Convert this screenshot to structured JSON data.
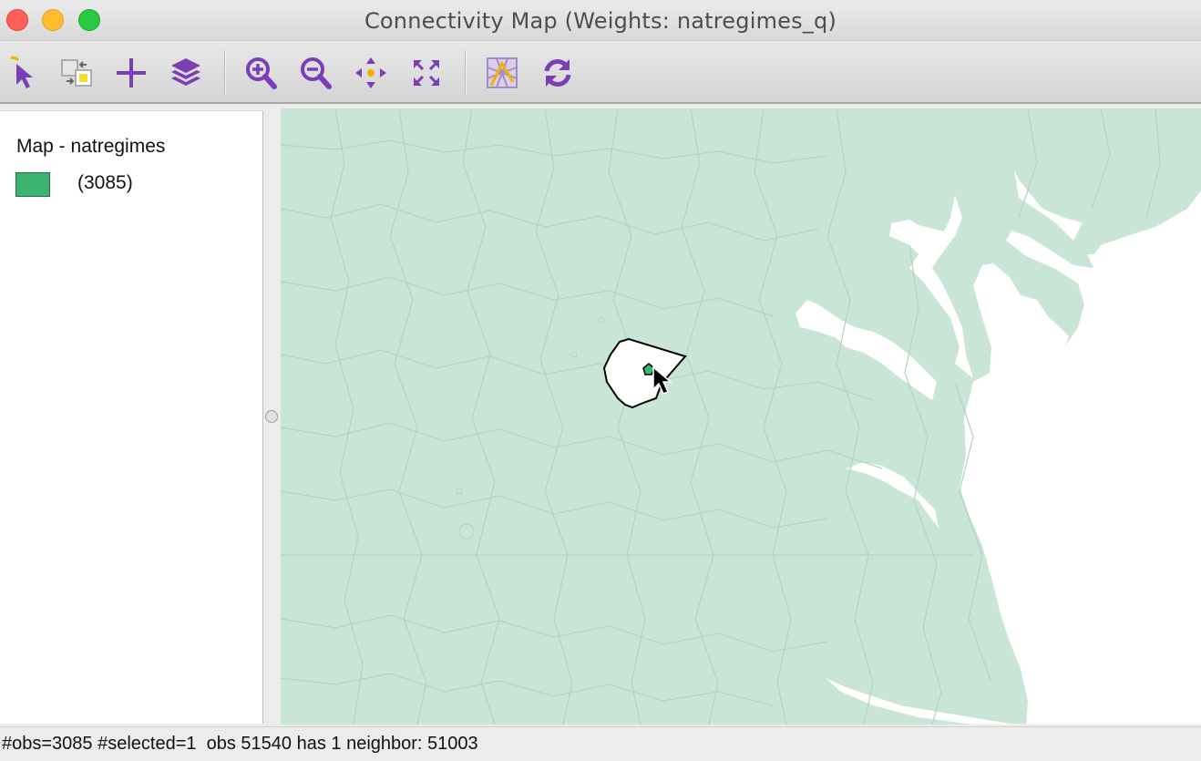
{
  "window": {
    "title": "Connectivity Map (Weights: natregimes_q)"
  },
  "toolbar": {
    "tools": [
      "select-tool",
      "selection-mode-tool",
      "add-tool",
      "layers-tool",
      "zoom-in-tool",
      "zoom-out-tool",
      "pan-tool",
      "fit-extent-tool",
      "basemap-tool",
      "refresh-tool"
    ],
    "accent_color": "#7b3fb5"
  },
  "legend": {
    "title": "Map - natregimes",
    "category_count": "(3085)",
    "swatch_color": "#3cb371"
  },
  "map": {
    "fill_color": "#c9e5d6",
    "boundary_color": "#b3d2c1",
    "selected_color": "#ffffff"
  },
  "status": {
    "text": "#obs=3085 #selected=1  obs 51540 has 1 neighbor: 51003"
  }
}
